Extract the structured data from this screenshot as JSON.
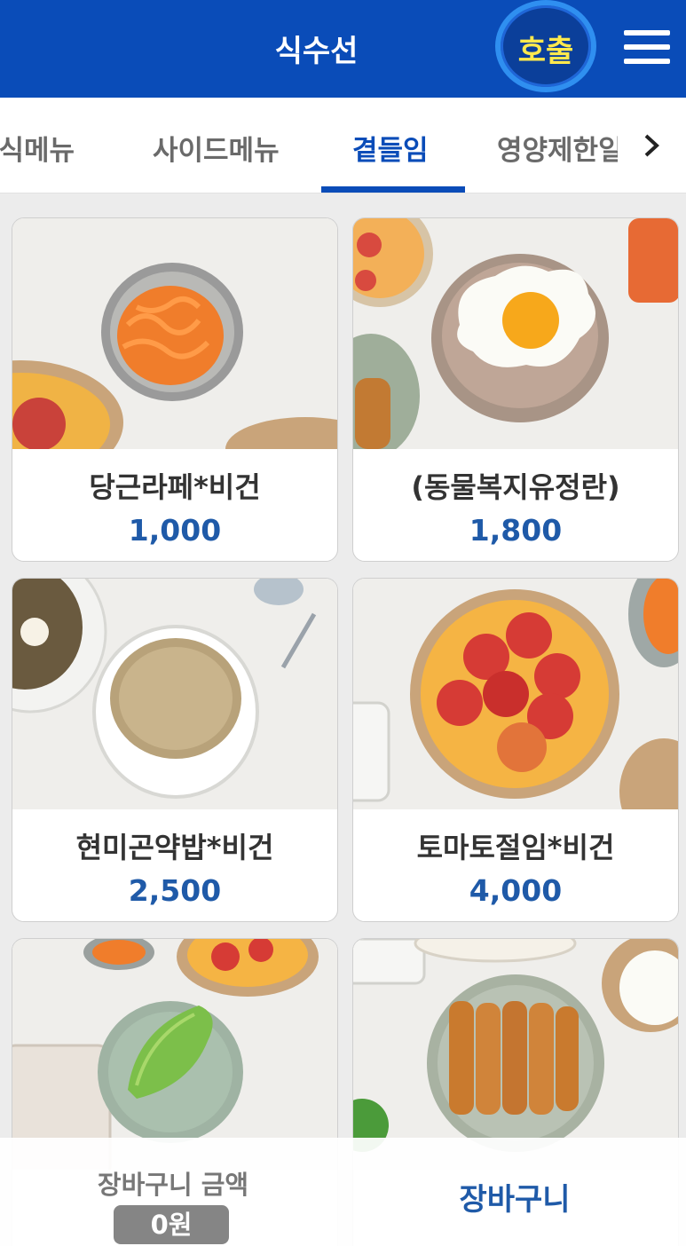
{
  "header": {
    "title": "식수선",
    "call_label": "호출"
  },
  "tabs": [
    {
      "label": "분식메뉴",
      "active": false
    },
    {
      "label": "사이드메뉴",
      "active": false
    },
    {
      "label": "곁들임",
      "active": true
    },
    {
      "label": "영양제한일",
      "active": false
    }
  ],
  "items": [
    {
      "name": "당근라페*비건",
      "price": "1,000"
    },
    {
      "name": "(동물복지유정란)",
      "price": "1,800"
    },
    {
      "name": "현미곤약밥*비건",
      "price": "2,500"
    },
    {
      "name": "토마토절임*비건",
      "price": "4,000"
    },
    {
      "name": "",
      "price": ""
    },
    {
      "name": "",
      "price": ""
    }
  ],
  "footer": {
    "cart_total_label": "장바구니 금액",
    "cart_total_value": "0원",
    "cart_button": "장바구니"
  },
  "colors": {
    "primary": "#0a4cb8",
    "call_text": "#ffe94d",
    "price": "#1f5aa8"
  }
}
